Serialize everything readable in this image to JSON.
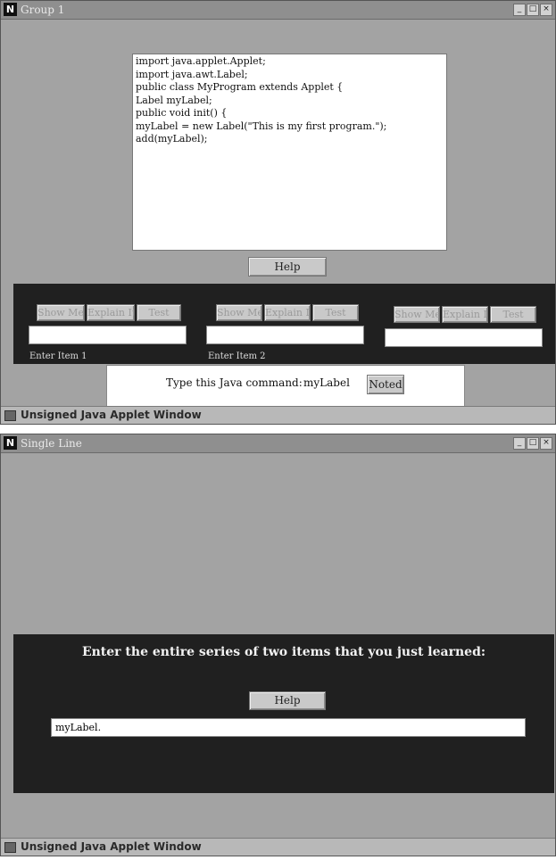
{
  "window1": {
    "title": "Group 1",
    "controls": [
      "_",
      "□",
      "×"
    ],
    "code_lines": [
      "import java.applet.Applet;",
      "import java.awt.Label;",
      "public class MyProgram extends Applet {",
      "Label myLabel;",
      "public void init() {",
      "myLabel = new Label(\"This is my first program.\");",
      "add(myLabel);"
    ],
    "help_label": "Help",
    "groups": [
      {
        "buttons": [
          "Show Me",
          "Explain It",
          "Test"
        ],
        "input_value": "",
        "label": "Enter Item 1"
      },
      {
        "buttons": [
          "Show Me",
          "Explain It",
          "Test"
        ],
        "input_value": "",
        "label": "Enter Item 2"
      },
      {
        "buttons": [
          "Show Me",
          "Explain It",
          "Test"
        ],
        "input_value": "",
        "label": ""
      }
    ],
    "command_prompt": "Type this Java command:",
    "command_value": "myLabel",
    "noted_label": "Noted",
    "status_text": "Unsigned Java Applet Window"
  },
  "window2": {
    "title": "Single Line",
    "controls": [
      "_",
      "□",
      "×"
    ],
    "prompt": "Enter the entire series of two items that you just learned:",
    "help_label": "Help",
    "input_value": "myLabel.",
    "status_text": "Unsigned Java Applet Window"
  }
}
